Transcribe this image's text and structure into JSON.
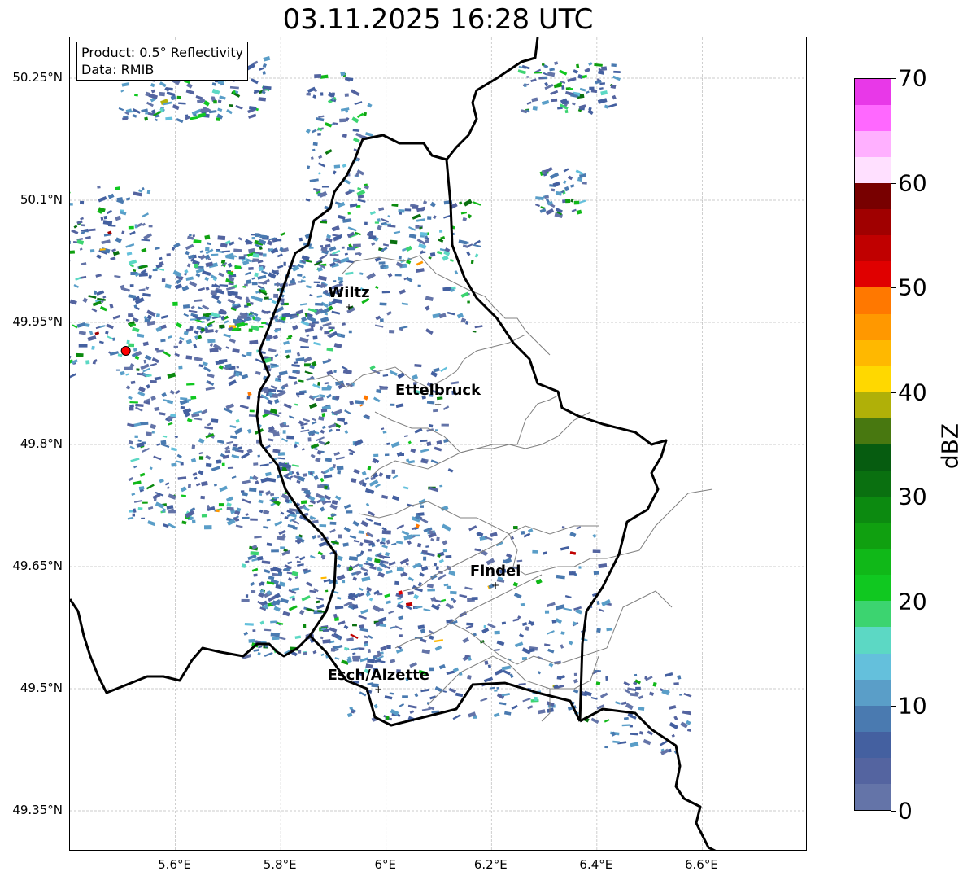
{
  "title": "03.11.2025 16:28 UTC",
  "info": {
    "product": "Product: 0.5° Reflectivity",
    "data": "Data: RMIB"
  },
  "map": {
    "extent": {
      "lon": [
        5.4,
        6.8
      ],
      "lat": [
        49.3,
        50.3
      ]
    },
    "lon_ticks": [
      {
        "v": 5.6,
        "label": "5.6°E"
      },
      {
        "v": 5.8,
        "label": "5.8°E"
      },
      {
        "v": 6.0,
        "label": "6°E"
      },
      {
        "v": 6.2,
        "label": "6.2°E"
      },
      {
        "v": 6.4,
        "label": "6.4°E"
      },
      {
        "v": 6.6,
        "label": "6.6°E"
      }
    ],
    "lat_ticks": [
      {
        "v": 50.25,
        "label": "50.25°N"
      },
      {
        "v": 50.1,
        "label": "50.1°N"
      },
      {
        "v": 49.95,
        "label": "49.95°N"
      },
      {
        "v": 49.8,
        "label": "49.8°N"
      },
      {
        "v": 49.65,
        "label": "49.65°N"
      },
      {
        "v": 49.5,
        "label": "49.5°N"
      },
      {
        "v": 49.35,
        "label": "49.35°N"
      }
    ],
    "cities": [
      {
        "name": "Wiltz",
        "lon": 5.931,
        "lat": 49.968
      },
      {
        "name": "Ettelbruck",
        "lon": 6.1,
        "lat": 49.848
      },
      {
        "name": "Findel",
        "lon": 6.209,
        "lat": 49.626
      },
      {
        "name": "Esch/Alzette",
        "lon": 5.987,
        "lat": 49.498
      }
    ],
    "radar_site": {
      "lon": 5.506,
      "lat": 49.915,
      "color": "#ff0000"
    }
  },
  "colorbar": {
    "label": "dBZ",
    "min": 0,
    "max": 70,
    "step": 2.5,
    "ticks": [
      "0",
      "10",
      "20",
      "30",
      "40",
      "50",
      "60",
      "70"
    ],
    "colors": [
      "#6474a8",
      "#5464a0",
      "#4460a0",
      "#4a7ab0",
      "#5a9ec8",
      "#64c0dc",
      "#5cd8c4",
      "#3cd470",
      "#10c820",
      "#10b818",
      "#10a010",
      "#0c8a10",
      "#0a7010",
      "#065c10",
      "#487810",
      "#b0b008",
      "#ffd800",
      "#ffb800",
      "#ff9800",
      "#ff7800",
      "#e00000",
      "#c00000",
      "#a00000",
      "#780000",
      "#ffe0ff",
      "#ffb0ff",
      "#ff68ff",
      "#e838e8"
    ]
  }
}
